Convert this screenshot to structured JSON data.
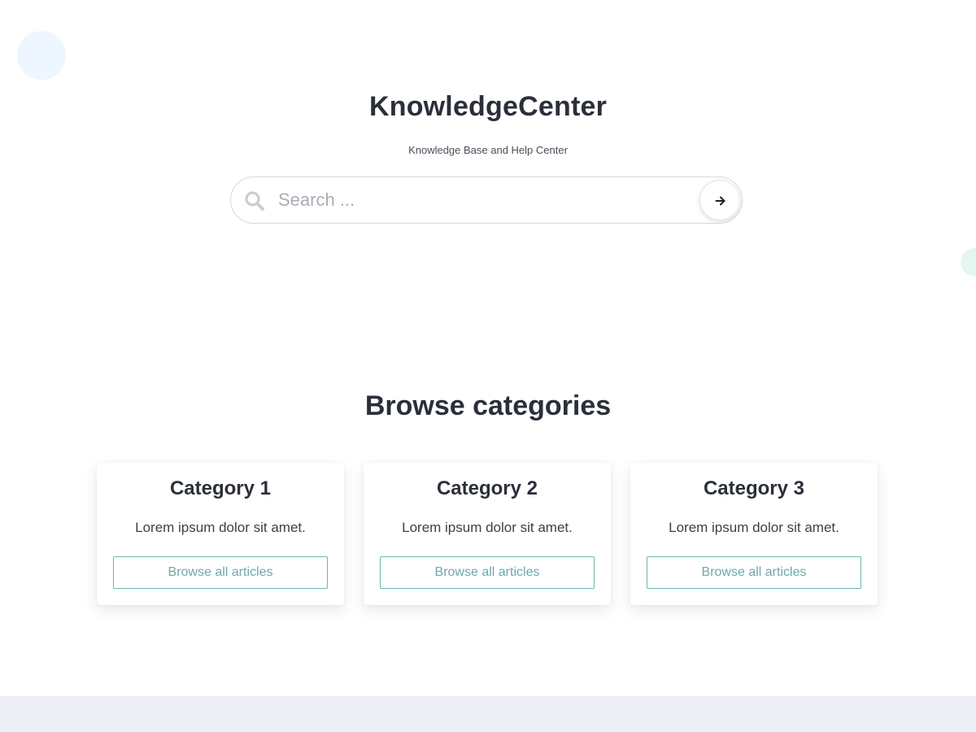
{
  "header": {
    "title": "KnowledgeCenter",
    "subtitle": "Knowledge Base and Help Center"
  },
  "search": {
    "placeholder": "Search ...",
    "value": "",
    "icon": "search-icon",
    "submit_icon": "arrow-right-icon"
  },
  "categories_section": {
    "title": "Browse categories",
    "items": [
      {
        "title": "Category 1",
        "description": "Lorem ipsum dolor sit amet.",
        "button_label": "Browse all articles"
      },
      {
        "title": "Category 2",
        "description": "Lorem ipsum dolor sit amet.",
        "button_label": "Browse all articles"
      },
      {
        "title": "Category 3",
        "description": "Lorem ipsum dolor sit amet.",
        "button_label": "Browse all articles"
      }
    ]
  },
  "colors": {
    "text_dark": "#2b2f3a",
    "accent_teal": "#6fb5b0",
    "footer_bg": "#eceff3",
    "deco_blue": "#eef6ff",
    "deco_green": "#e3f7ef"
  }
}
